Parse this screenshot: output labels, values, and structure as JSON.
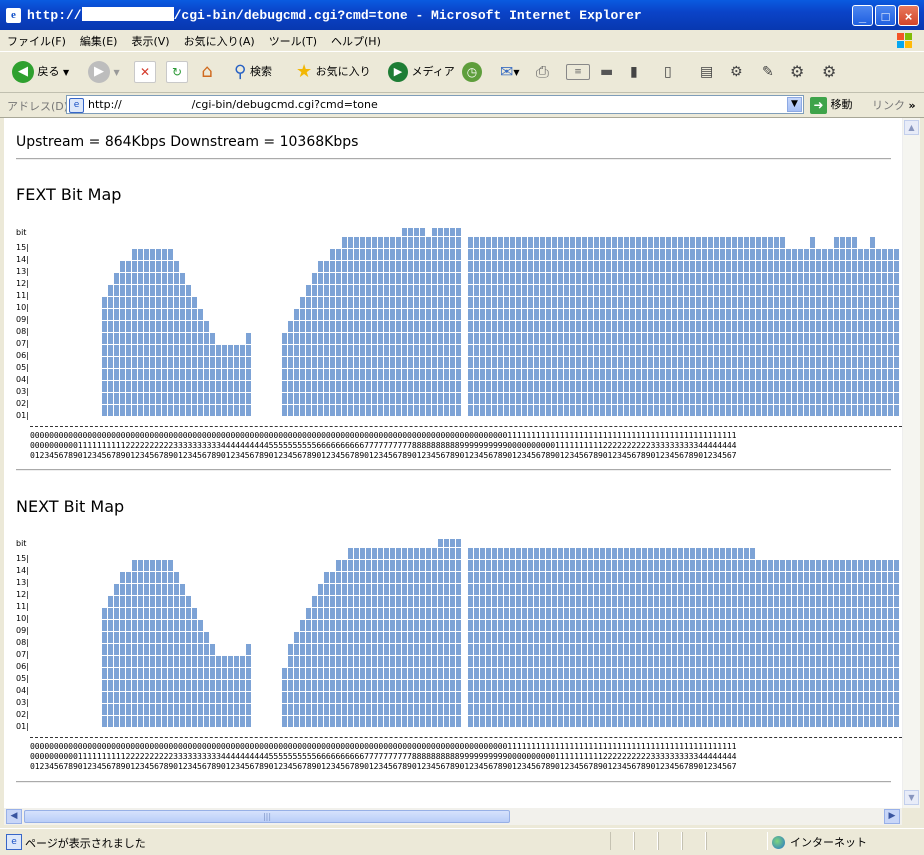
{
  "window": {
    "title_prefix": "http://",
    "title_suffix": "/cgi-bin/debugcmd.cgi?cmd=tone - Microsoft Internet Explorer",
    "minimize": "_",
    "maximize": "□",
    "close": "×"
  },
  "menu": [
    "ファイル(F)",
    "編集(E)",
    "表示(V)",
    "お気に入り(A)",
    "ツール(T)",
    "ヘルプ(H)"
  ],
  "toolbar": {
    "back": "戻る",
    "search": "検索",
    "favorites": "お気に入り",
    "media": "メディア"
  },
  "address": {
    "label": "アドレス(D)",
    "url": "http://                    /cgi-bin/debugcmd.cgi?cmd=tone",
    "go": "移動",
    "links": "リンク"
  },
  "page": {
    "rate_text": "Upstream = 864Kbps Downstream = 10368Kbps",
    "fext_title": "FEXT Bit Map",
    "next_title": "NEXT Bit Map",
    "bit_label": "bit",
    "y_labels": [
      "15|",
      "14|",
      "13|",
      "12|",
      "11|",
      "10|",
      "09|",
      "08|",
      "07|",
      "06|",
      "05|",
      "04|",
      "03|",
      "02|",
      "01|"
    ],
    "index_row1": "0000000000000000000000000000000000000000000000000000000000000000000000000000000000000000000000000000111111111111111111111111111111111111111111111111",
    "index_row2": "0000000000111111111122222222223333333333444444444455555555556666666666777777777788888888889999999999000000000011111111112222222222333333333344444444",
    "index_row3": "0123456789012345678901234567890123456789012345678901234567890123456789012345678901234567890123456789012345678901234567890123456789012345678901234567"
  },
  "chart_data": [
    {
      "type": "bar",
      "title": "FEXT Bit Map",
      "ylabel": "bit",
      "ylim": [
        0,
        15
      ],
      "x_start": 0,
      "values": [
        0,
        0,
        0,
        0,
        0,
        0,
        10,
        11,
        12,
        13,
        13,
        14,
        14,
        14,
        14,
        14,
        14,
        14,
        13,
        12,
        11,
        10,
        9,
        8,
        7,
        6,
        6,
        6,
        6,
        6,
        7,
        0,
        0,
        0,
        0,
        0,
        7,
        8,
        9,
        10,
        11,
        12,
        13,
        13,
        14,
        14,
        15,
        15,
        15,
        15,
        15,
        15,
        15,
        15,
        15,
        15,
        16,
        16,
        16,
        16,
        15,
        16,
        16,
        16,
        16,
        16,
        0,
        15,
        15,
        15,
        15,
        15,
        15,
        15,
        15,
        15,
        15,
        15,
        15,
        15,
        15,
        15,
        15,
        15,
        15,
        15,
        15,
        15,
        15,
        15,
        15,
        15,
        15,
        15,
        15,
        15,
        15,
        15,
        15,
        15,
        15,
        15,
        15,
        15,
        15,
        15,
        15,
        15,
        15,
        15,
        15,
        15,
        15,
        15,
        15,
        15,
        15,
        15,
        15,
        15,
        14,
        14,
        14,
        14,
        15,
        14,
        14,
        14,
        15,
        15,
        15,
        15,
        14,
        14,
        15,
        14,
        14,
        14,
        14,
        14,
        14,
        14,
        14,
        14,
        14,
        14,
        14,
        14,
        14,
        14,
        14,
        14,
        14,
        14,
        14,
        14,
        14,
        14
      ]
    },
    {
      "type": "bar",
      "title": "NEXT Bit Map",
      "ylabel": "bit",
      "ylim": [
        0,
        15
      ],
      "x_start": 0,
      "values": [
        0,
        0,
        0,
        0,
        0,
        0,
        10,
        11,
        12,
        13,
        13,
        14,
        14,
        14,
        14,
        14,
        14,
        14,
        13,
        12,
        11,
        10,
        9,
        8,
        7,
        6,
        6,
        6,
        6,
        6,
        7,
        0,
        0,
        0,
        0,
        0,
        5,
        7,
        8,
        9,
        10,
        11,
        12,
        13,
        13,
        14,
        14,
        15,
        15,
        15,
        15,
        15,
        15,
        15,
        15,
        15,
        15,
        15,
        15,
        15,
        15,
        15,
        16,
        16,
        16,
        16,
        0,
        15,
        15,
        15,
        15,
        15,
        15,
        15,
        15,
        15,
        15,
        15,
        15,
        15,
        15,
        15,
        15,
        15,
        15,
        15,
        15,
        15,
        15,
        15,
        15,
        15,
        15,
        15,
        15,
        15,
        15,
        15,
        15,
        15,
        15,
        15,
        15,
        15,
        15,
        15,
        15,
        15,
        15,
        15,
        15,
        15,
        15,
        15,
        15,
        14,
        14,
        14,
        14,
        14,
        14,
        14,
        14,
        14,
        14,
        14,
        14,
        14,
        14,
        14,
        14,
        14,
        14,
        14,
        14,
        14,
        14,
        14,
        14,
        14,
        14,
        14,
        14,
        14,
        14,
        14,
        14,
        14,
        14,
        14,
        14,
        14,
        14,
        14,
        14,
        14,
        14,
        14
      ]
    }
  ],
  "status": {
    "text": "ページが表示されました",
    "zone": "インターネット"
  },
  "colors": {
    "bar_fill": "#7DA3D6",
    "title_bar": "#0A46C8"
  }
}
